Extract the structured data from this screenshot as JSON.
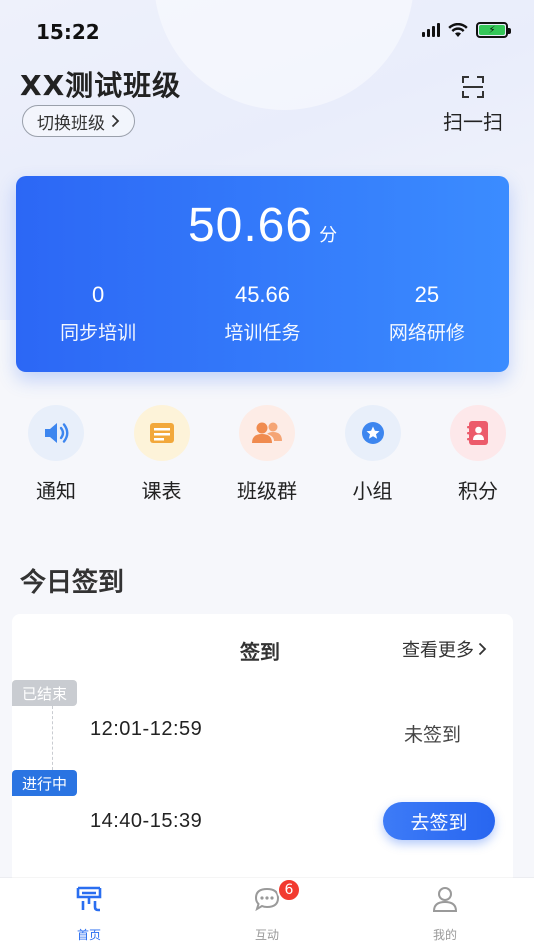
{
  "status_bar": {
    "time": "15:22"
  },
  "header": {
    "class_name": "XX测试班级",
    "switch_label": "切换班级",
    "scan_label": "扫一扫"
  },
  "score_card": {
    "score": "50.66",
    "unit": "分",
    "stats": [
      {
        "value": "0",
        "label": "同步培训"
      },
      {
        "value": "45.66",
        "label": "培训任务"
      },
      {
        "value": "25",
        "label": "网络研修"
      }
    ]
  },
  "shortcuts": [
    {
      "label": "通知",
      "icon": "speaker-icon",
      "bg": "#e8effa",
      "color": "#3d86ef"
    },
    {
      "label": "课表",
      "icon": "schedule-icon",
      "bg": "#fdf3d9",
      "color": "#f2a83b"
    },
    {
      "label": "班级群",
      "icon": "group-chat-icon",
      "bg": "#fdece6",
      "color": "#f08b4f"
    },
    {
      "label": "小组",
      "icon": "star-badge-icon",
      "bg": "#e8effa",
      "color": "#3d86ef"
    },
    {
      "label": "积分",
      "icon": "contact-book-icon",
      "bg": "#fde8ea",
      "color": "#ec5b6b"
    }
  ],
  "checkin": {
    "section_title": "今日签到",
    "header": "签到",
    "view_more": "查看更多",
    "sessions": [
      {
        "badge": "已结束",
        "time": "12:01-12:59",
        "status": "未签到"
      },
      {
        "badge": "进行中",
        "time": "14:40-15:39",
        "action": "去签到"
      }
    ]
  },
  "tabbar": {
    "items": [
      {
        "label": "首页",
        "icon": "home-icon",
        "active": true
      },
      {
        "label": "互动",
        "icon": "chat-bubble-icon",
        "badge": "6"
      },
      {
        "label": "我的",
        "icon": "profile-icon"
      }
    ]
  },
  "colors": {
    "primary": "#2a6ef0",
    "card_gradient_start": "#2c67f5",
    "card_gradient_end": "#3b8cff",
    "badge_red": "#f23a2f",
    "ended_gray": "#c9ccd1"
  }
}
